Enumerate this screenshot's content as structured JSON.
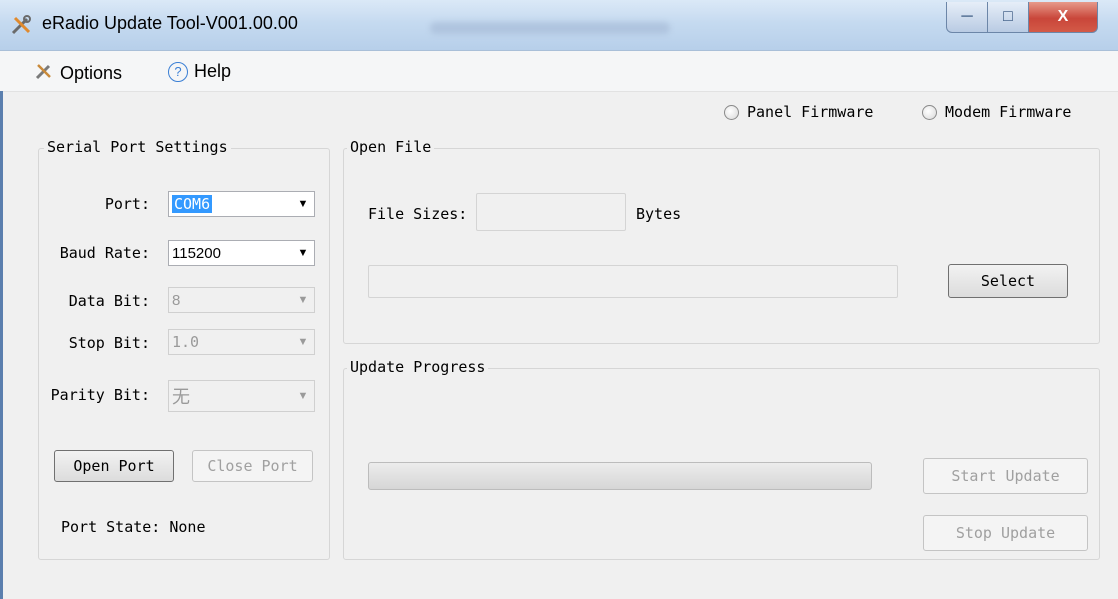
{
  "window": {
    "title": "eRadio Update Tool-V001.00.00",
    "min_glyph": "─",
    "max_glyph": "□",
    "close_glyph": "X"
  },
  "menu": {
    "options_label": "Options",
    "help_label": "Help",
    "help_glyph": "?"
  },
  "firmware_mode": {
    "panel_label": "Panel Firmware",
    "modem_label": "Modem Firmware"
  },
  "serial_settings": {
    "title": "Serial Port Settings",
    "port": {
      "label": "Port:",
      "value": "COM6"
    },
    "baud_rate": {
      "label": "Baud Rate:",
      "value": "115200"
    },
    "data_bit": {
      "label": "Data Bit:",
      "value": "8"
    },
    "stop_bit": {
      "label": "Stop Bit:",
      "value": "1.0"
    },
    "parity_bit": {
      "label": "Parity Bit:",
      "value": "无"
    },
    "open_port_label": "Open Port",
    "close_port_label": "Close Port",
    "port_state_label": "Port State:",
    "port_state_value": "None"
  },
  "open_file": {
    "title": "Open File",
    "file_sizes_label": "File Sizes:",
    "file_sizes_value": "",
    "bytes_label": "Bytes",
    "path_value": "",
    "select_label": "Select"
  },
  "update_progress": {
    "title": "Update Progress",
    "progress": 0,
    "start_label": "Start Update",
    "stop_label": "Stop Update"
  },
  "colors": {
    "title_bar": "#c5daf0",
    "close_button": "#c9463a",
    "selection": "#3399ff",
    "window_bg": "#f0f0f0"
  }
}
